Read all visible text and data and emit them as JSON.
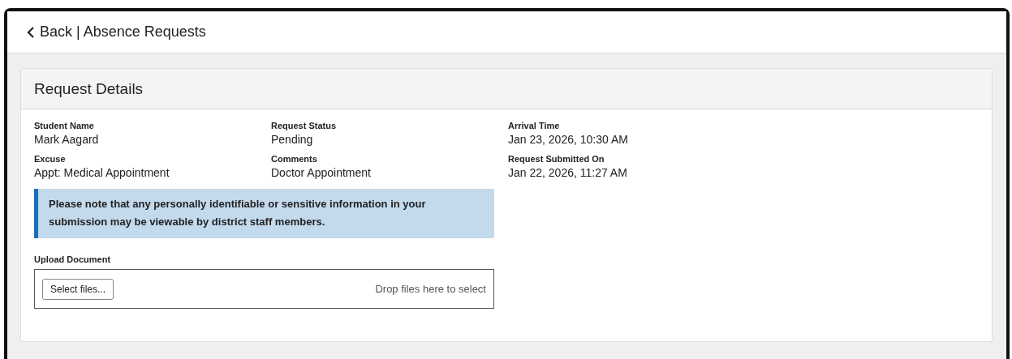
{
  "header": {
    "back_link": "Back | Absence Requests"
  },
  "card": {
    "title": "Request Details",
    "fields": [
      {
        "label": "Student Name",
        "value": "Mark Aagard"
      },
      {
        "label": "Request Status",
        "value": "Pending"
      },
      {
        "label": "Arrival Time",
        "value": "Jan 23, 2026, 10:30 AM"
      },
      {
        "label": "Excuse",
        "value": "Appt: Medical Appointment"
      },
      {
        "label": "Comments",
        "value": "Doctor Appointment"
      },
      {
        "label": "Request Submitted On",
        "value": "Jan 22, 2026, 11:27 AM"
      }
    ],
    "notice": "Please note that any personally identifiable or sensitive information in your submission may be viewable by district staff members.",
    "upload": {
      "label": "Upload Document",
      "button": "Select files...",
      "drop_hint": "Drop files here to select"
    }
  }
}
